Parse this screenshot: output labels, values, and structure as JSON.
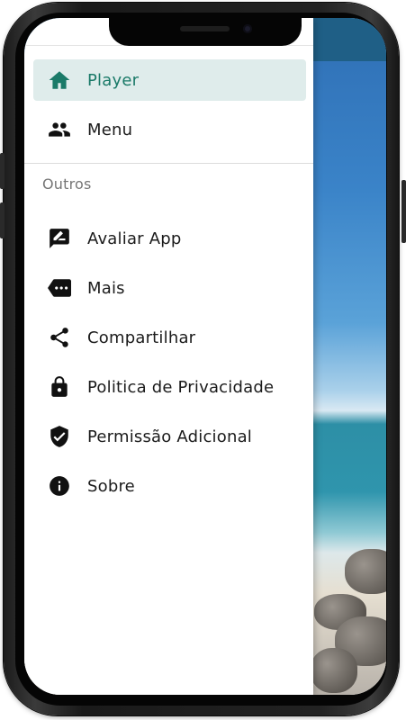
{
  "drawer": {
    "items": [
      {
        "label": "Player",
        "icon": "home-icon",
        "active": true
      },
      {
        "label": "Menu",
        "icon": "people-icon",
        "active": false
      }
    ],
    "section_title": "Outros",
    "other_items": [
      {
        "label": "Avaliar App",
        "icon": "rate-review-icon"
      },
      {
        "label": "Mais",
        "icon": "more-tag-icon"
      },
      {
        "label": "Compartilhar",
        "icon": "share-icon"
      },
      {
        "label": "Politica de Privacidade",
        "icon": "lock-icon"
      },
      {
        "label": "Permissão Adicional",
        "icon": "verified-shield-icon"
      },
      {
        "label": "Sobre",
        "icon": "info-icon"
      }
    ]
  },
  "colors": {
    "accent": "#1a7a68",
    "active_bg": "#dfeceb",
    "text": "#1b1b1b",
    "section_title": "#767676"
  }
}
